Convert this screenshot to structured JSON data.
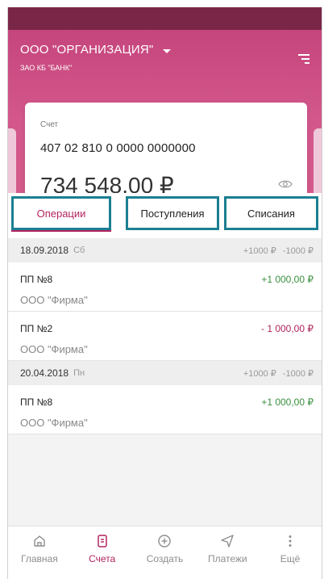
{
  "header": {
    "org_name": "ООО \"ОРГАНИЗАЦИЯ\"",
    "bank_name": "ЗАО КБ \"БАНК\""
  },
  "account_card": {
    "label": "Счет",
    "number": "407 02 810 0 0000 0000000",
    "balance": "734 548,00 ₽",
    "pager_active": 2,
    "pager_total": 3
  },
  "tabs": [
    {
      "label": "Операции",
      "active": true
    },
    {
      "label": "Поступления",
      "active": false
    },
    {
      "label": "Списания",
      "active": false
    }
  ],
  "groups": [
    {
      "date": "18.09.2018",
      "day": "Сб",
      "income_sum": "+1000 ₽",
      "expense_sum": "-1000 ₽",
      "operations": [
        {
          "title": "ПП №8",
          "counterparty": "ООО \"Фирма\"",
          "amount": "+1 000,00 ₽",
          "direction": "in"
        },
        {
          "title": "ПП №2",
          "counterparty": "ООО \"Фирма\"",
          "amount": "- 1 000,00 ₽",
          "direction": "out"
        }
      ]
    },
    {
      "date": "20.04.2018",
      "day": "Пн",
      "income_sum": "+1000 ₽",
      "expense_sum": "-1000 ₽",
      "operations": [
        {
          "title": "ПП №8",
          "counterparty": "ООО \"Фирма\"",
          "amount": "+1 000,00 ₽",
          "direction": "in"
        }
      ]
    }
  ],
  "bottom_nav": [
    {
      "label": "Главная",
      "icon": "home-icon",
      "active": false
    },
    {
      "label": "Счета",
      "icon": "document-icon",
      "active": true
    },
    {
      "label": "Создать",
      "icon": "plus-circle-icon",
      "active": false
    },
    {
      "label": "Платежи",
      "icon": "send-icon",
      "active": false
    },
    {
      "label": "Ещё",
      "icon": "more-vertical-icon",
      "active": false
    }
  ],
  "colors": {
    "header_bg": "#d3578b",
    "accent": "#b2235f",
    "positive": "#3a8f3f",
    "negative": "#b0235a",
    "highlight_border": "#1c7f92"
  }
}
